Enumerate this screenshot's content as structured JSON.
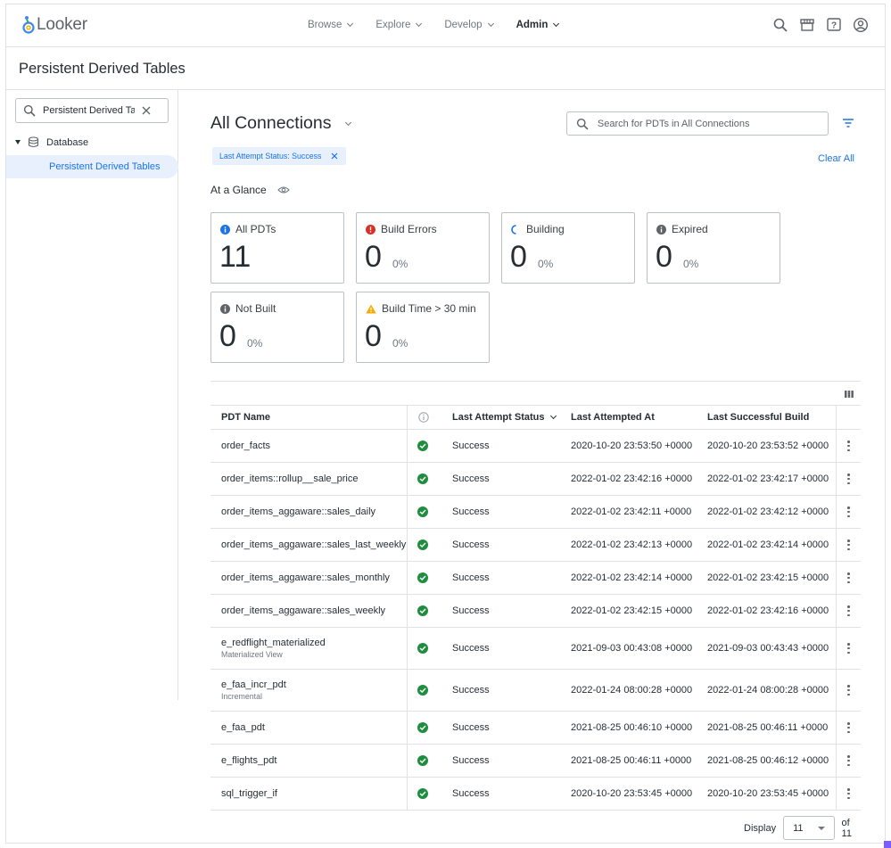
{
  "app": {
    "name": "Looker"
  },
  "nav": {
    "items": [
      {
        "label": "Browse",
        "active": false
      },
      {
        "label": "Explore",
        "active": false
      },
      {
        "label": "Develop",
        "active": false
      },
      {
        "label": "Admin",
        "active": true
      }
    ],
    "icons": [
      "search-icon",
      "marketplace-icon",
      "help-icon",
      "account-icon"
    ]
  },
  "page": {
    "title": "Persistent Derived Tables"
  },
  "sidebar": {
    "search_value": "Persistent Derived Tables",
    "tree": {
      "group_label": "Database",
      "selected_item": "Persistent Derived Tables"
    }
  },
  "main": {
    "connection_title": "All Connections",
    "search_placeholder": "Search for PDTs in All Connections",
    "filter_chip": "Last Attempt Status: Success",
    "clear_all": "Clear All",
    "glance_label": "At a Glance",
    "cards": [
      {
        "label": "All PDTs",
        "value": "11",
        "pct": "",
        "icon": "info-icon",
        "color": "#1a73e8"
      },
      {
        "label": "Build Errors",
        "value": "0",
        "pct": "0%",
        "icon": "error-icon",
        "color": "#d93025"
      },
      {
        "label": "Building",
        "value": "0",
        "pct": "0%",
        "icon": "spinner-icon",
        "color": "#1a73e8"
      },
      {
        "label": "Expired",
        "value": "0",
        "pct": "0%",
        "icon": "info-icon",
        "color": "#5f6368"
      },
      {
        "label": "Not Built",
        "value": "0",
        "pct": "0%",
        "icon": "info-icon",
        "color": "#5f6368"
      },
      {
        "label": "Build Time > 30 min",
        "value": "0",
        "pct": "0%",
        "icon": "warning-icon",
        "color": "#f9ab00"
      }
    ]
  },
  "table": {
    "headers": {
      "name": "PDT Name",
      "status": "Last Attempt Status",
      "attempted": "Last Attempted At",
      "successful": "Last Successful Build"
    },
    "rows": [
      {
        "name": "order_facts",
        "sub": "",
        "status": "Success",
        "attempted": "2020-10-20 23:53:50 +0000",
        "successful": "2020-10-20 23:53:52 +0000"
      },
      {
        "name": "order_items::rollup__sale_price",
        "sub": "",
        "status": "Success",
        "attempted": "2022-01-02 23:42:16 +0000",
        "successful": "2022-01-02 23:42:17 +0000"
      },
      {
        "name": "order_items_aggaware::sales_daily",
        "sub": "",
        "status": "Success",
        "attempted": "2022-01-02 23:42:11 +0000",
        "successful": "2022-01-02 23:42:12 +0000"
      },
      {
        "name": "order_items_aggaware::sales_last_weekly",
        "sub": "",
        "status": "Success",
        "attempted": "2022-01-02 23:42:13 +0000",
        "successful": "2022-01-02 23:42:14 +0000"
      },
      {
        "name": "order_items_aggaware::sales_monthly",
        "sub": "",
        "status": "Success",
        "attempted": "2022-01-02 23:42:14 +0000",
        "successful": "2022-01-02 23:42:15 +0000"
      },
      {
        "name": "order_items_aggaware::sales_weekly",
        "sub": "",
        "status": "Success",
        "attempted": "2022-01-02 23:42:15 +0000",
        "successful": "2022-01-02 23:42:16 +0000"
      },
      {
        "name": "e_redflight_materialized",
        "sub": "Materialized View",
        "status": "Success",
        "attempted": "2021-09-03 00:43:08 +0000",
        "successful": "2021-09-03 00:43:43 +0000"
      },
      {
        "name": "e_faa_incr_pdt",
        "sub": "Incremental",
        "status": "Success",
        "attempted": "2022-01-24 08:00:28 +0000",
        "successful": "2022-01-24 08:00:28 +0000"
      },
      {
        "name": "e_faa_pdt",
        "sub": "",
        "status": "Success",
        "attempted": "2021-08-25 00:46:10 +0000",
        "successful": "2021-08-25 00:46:11 +0000"
      },
      {
        "name": "e_flights_pdt",
        "sub": "",
        "status": "Success",
        "attempted": "2021-08-25 00:46:11 +0000",
        "successful": "2021-08-25 00:46:12 +0000"
      },
      {
        "name": "sql_trigger_if",
        "sub": "",
        "status": "Success",
        "attempted": "2020-10-20 23:53:45 +0000",
        "successful": "2020-10-20 23:53:45 +0000"
      }
    ]
  },
  "pagination": {
    "display_label": "Display",
    "per_page": "11",
    "of_label": "of 11"
  }
}
